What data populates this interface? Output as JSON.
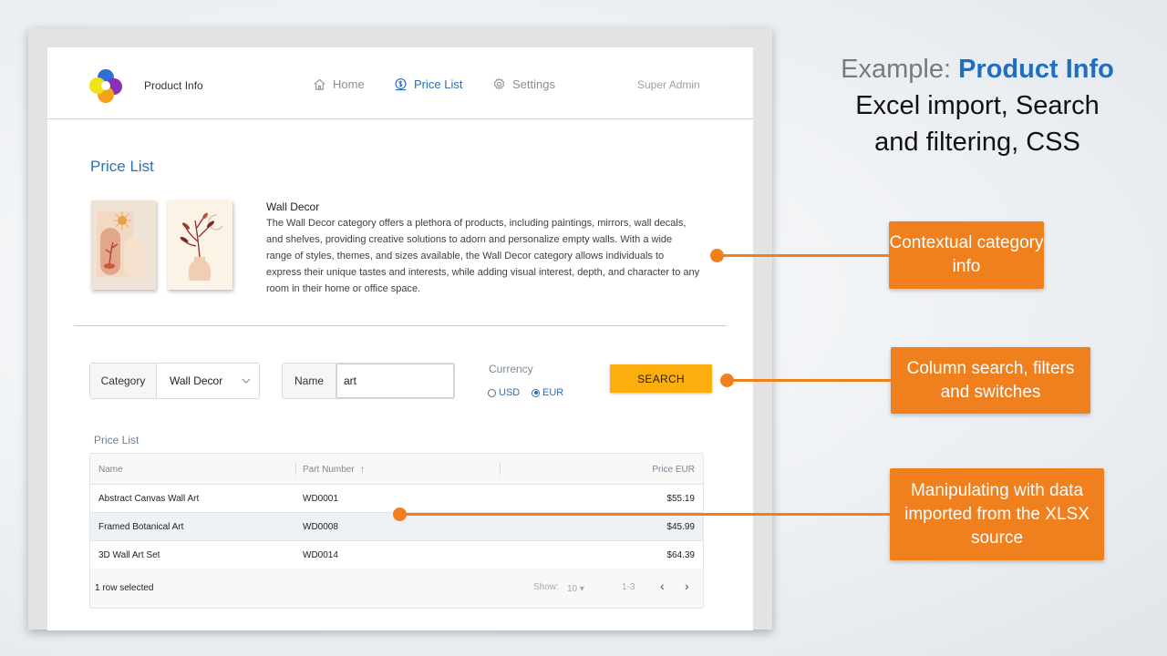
{
  "slide": {
    "title_prefix": "Example: ",
    "title_product": "Product Info",
    "title_line2": "Excel import, Search",
    "title_line3": "and filtering, CSS",
    "callouts": [
      "Contextual category info",
      "Column search, filters and switches",
      "Manipulating with data imported from the XLSX source"
    ],
    "accent_color": "#f07f1e"
  },
  "header": {
    "brand": "Product Info",
    "nav": [
      {
        "label": "Home",
        "icon": "home-icon"
      },
      {
        "label": "Price List",
        "icon": "price-icon",
        "active": true
      },
      {
        "label": "Settings",
        "icon": "gear-icon"
      }
    ],
    "user": "Super Admin"
  },
  "page": {
    "title": "Price List",
    "category_title": "Wall Decor",
    "category_desc": "The Wall Decor category offers a plethora of products, including paintings, mirrors, wall decals, and shelves, providing creative solutions to adorn and personalize empty walls. With a wide range of styles, themes, and sizes available, the Wall Decor category allows individuals to express their unique tastes and interests, while adding visual interest, depth, and character to any room in their home or office space."
  },
  "search": {
    "category_label": "Category",
    "category_value": "Wall Decor",
    "name_label": "Name",
    "name_value": "art",
    "currency_label": "Currency",
    "currency_options": [
      "USD",
      "EUR"
    ],
    "currency_selected": "EUR",
    "button": "SEARCH",
    "button_color": "#fcae0f"
  },
  "grid": {
    "title": "Price List",
    "columns": [
      "Name",
      "Part Number",
      "Price EUR"
    ],
    "rows": [
      [
        "Abstract Canvas Wall Art",
        "WD0001",
        "$55.19"
      ],
      [
        "Framed Botanical Art",
        "WD0008",
        "$45.99"
      ],
      [
        "3D Wall Art Set",
        "WD0014",
        "$64.39"
      ]
    ],
    "footer": {
      "selected": "1 row selected",
      "show_label": "Show:",
      "show_value": "10",
      "range": "1-3"
    }
  }
}
